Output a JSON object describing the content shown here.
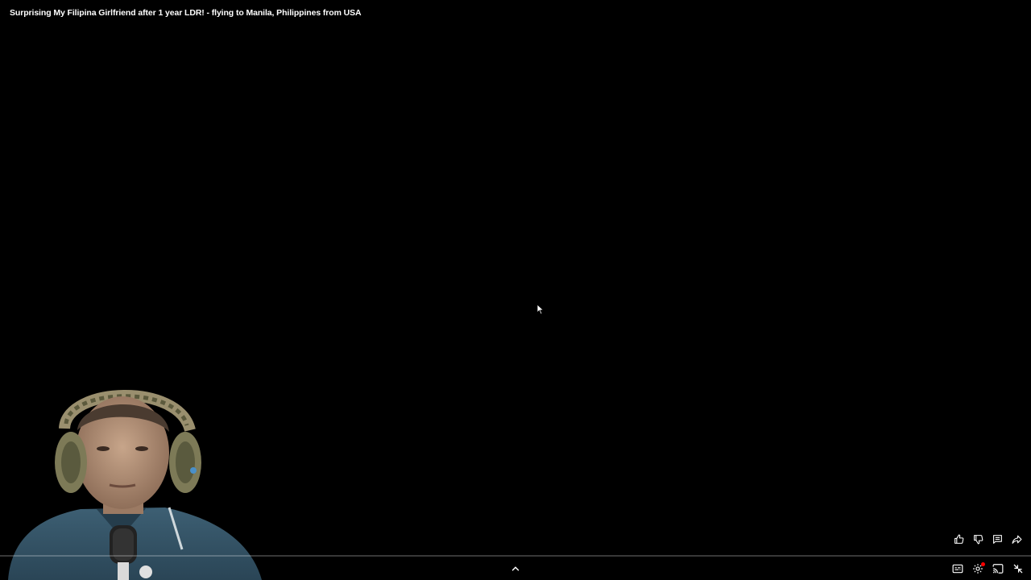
{
  "video": {
    "title": "Surprising My Filipina Girlfriend after 1 year LDR! - flying to Manila, Philippines from USA"
  },
  "controls": {
    "actions": [
      {
        "name": "like-button",
        "icon": "thumbs-up-icon"
      },
      {
        "name": "dislike-button",
        "icon": "thumbs-down-icon"
      },
      {
        "name": "comments-button",
        "icon": "comment-icon"
      },
      {
        "name": "share-button",
        "icon": "share-icon"
      }
    ],
    "bottom": [
      {
        "name": "captions-button",
        "icon": "captions-icon"
      },
      {
        "name": "settings-button",
        "icon": "gear-icon"
      },
      {
        "name": "cast-button",
        "icon": "cast-icon"
      },
      {
        "name": "exit-fullscreen-button",
        "icon": "exit-fullscreen-icon"
      }
    ],
    "progress": 0
  },
  "colors": {
    "background": "#000000",
    "accent": "#ff0000",
    "icon": "#ffffff"
  }
}
